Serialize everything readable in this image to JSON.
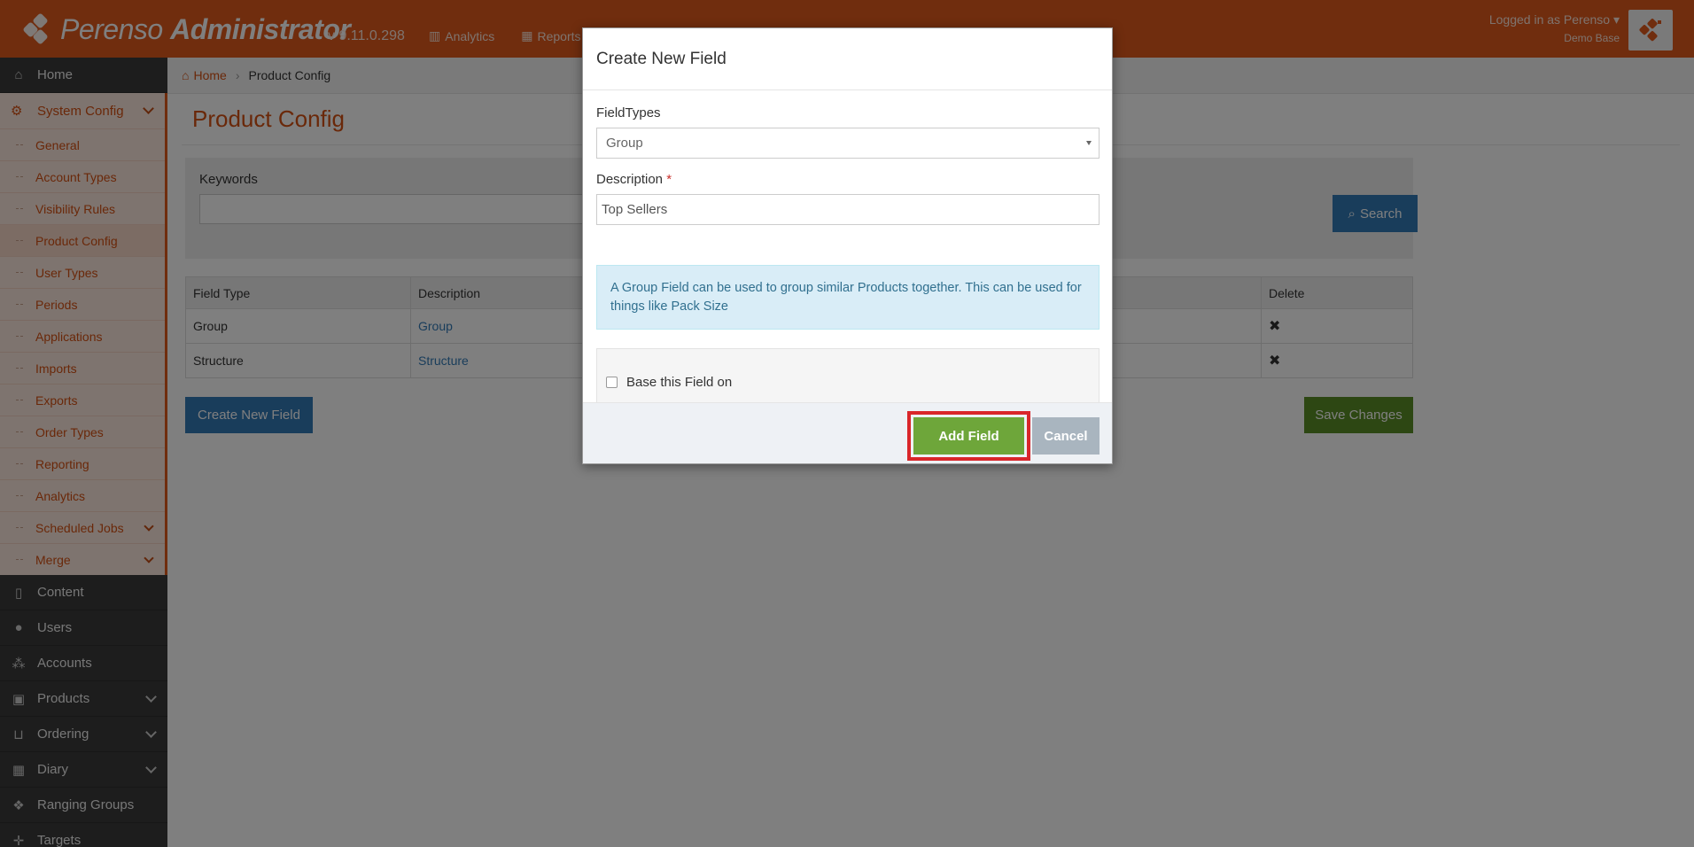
{
  "header": {
    "brand_light": "Perenso",
    "brand_bold": "Administrator",
    "version": "v 9.11.0.298",
    "nav": [
      {
        "label": "Analytics",
        "icon": "bar-chart-icon"
      },
      {
        "label": "Reports",
        "icon": "table-icon"
      }
    ],
    "user_line": "Logged in as Perenso",
    "user_sub": "Demo Base"
  },
  "sidebar": {
    "home": "Home",
    "system_config": "System Config",
    "system_items": [
      "General",
      "Account Types",
      "Visibility Rules",
      "Product Config",
      "User Types",
      "Periods",
      "Applications",
      "Imports",
      "Exports",
      "Order Types",
      "Reporting",
      "Analytics",
      "Scheduled Jobs",
      "Merge"
    ],
    "active_item": "Product Config",
    "items": [
      {
        "label": "Content",
        "icon": "file-icon"
      },
      {
        "label": "Users",
        "icon": "user-icon"
      },
      {
        "label": "Accounts",
        "icon": "users-group-icon"
      },
      {
        "label": "Products",
        "icon": "gift-icon"
      },
      {
        "label": "Ordering",
        "icon": "cart-icon"
      },
      {
        "label": "Diary",
        "icon": "calendar-icon"
      },
      {
        "label": "Ranging Groups",
        "icon": "cubes-icon"
      },
      {
        "label": "Targets",
        "icon": "crosshair-icon"
      }
    ]
  },
  "breadcrumb": {
    "home": "Home",
    "current": "Product Config"
  },
  "page": {
    "title": "Product Config",
    "keywords_label": "Keywords",
    "search_label": "Search",
    "table": {
      "headers": [
        "Field Type",
        "Description",
        "Delete"
      ],
      "rows": [
        {
          "type": "Group",
          "description": "Group"
        },
        {
          "type": "Structure",
          "description": "Structure"
        }
      ]
    },
    "create_label": "Create New Field",
    "save_label": "Save Changes"
  },
  "modal": {
    "title": "Create New Field",
    "fieldtypes_label": "FieldTypes",
    "fieldtypes_value": "Group",
    "description_label": "Description",
    "required_mark": "*",
    "description_value": "Top Sellers",
    "info_text": "A Group Field can be used to group similar Products together. This can be used for things like Pack Size",
    "checkbox_label": "Base this Field on",
    "add_label": "Add Field",
    "cancel_label": "Cancel"
  },
  "colors": {
    "brand": "#e05a1c",
    "primary": "#337ab7",
    "success": "#6ea63a",
    "highlight": "#d9262a"
  }
}
